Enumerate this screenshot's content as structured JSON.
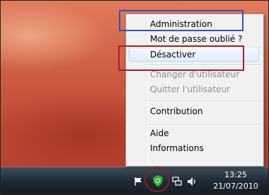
{
  "context_menu": {
    "items": [
      {
        "label": "Administration",
        "enabled": true
      },
      {
        "label": "Mot de passe oublié ?",
        "enabled": true
      },
      {
        "label": "Désactiver",
        "enabled": true,
        "hovered": true
      },
      {
        "label": "Changer d'utilisateur",
        "enabled": false
      },
      {
        "label": "Quitter l'utilisateur",
        "enabled": false
      },
      {
        "label": "Contribution",
        "enabled": true
      },
      {
        "label": "Aide",
        "enabled": true
      },
      {
        "label": "Informations",
        "enabled": true
      }
    ]
  },
  "taskbar": {
    "tray_icons": [
      "flag-icon",
      "app-tray-icon",
      "network-icon",
      "volume-icon"
    ],
    "clock": {
      "time": "13:25",
      "date": "21/07/2010"
    }
  },
  "annotations": {
    "colors": {
      "blue_box": "#2b57b8",
      "red_box": "#a3222e",
      "circle": "#8e1a2a"
    }
  }
}
